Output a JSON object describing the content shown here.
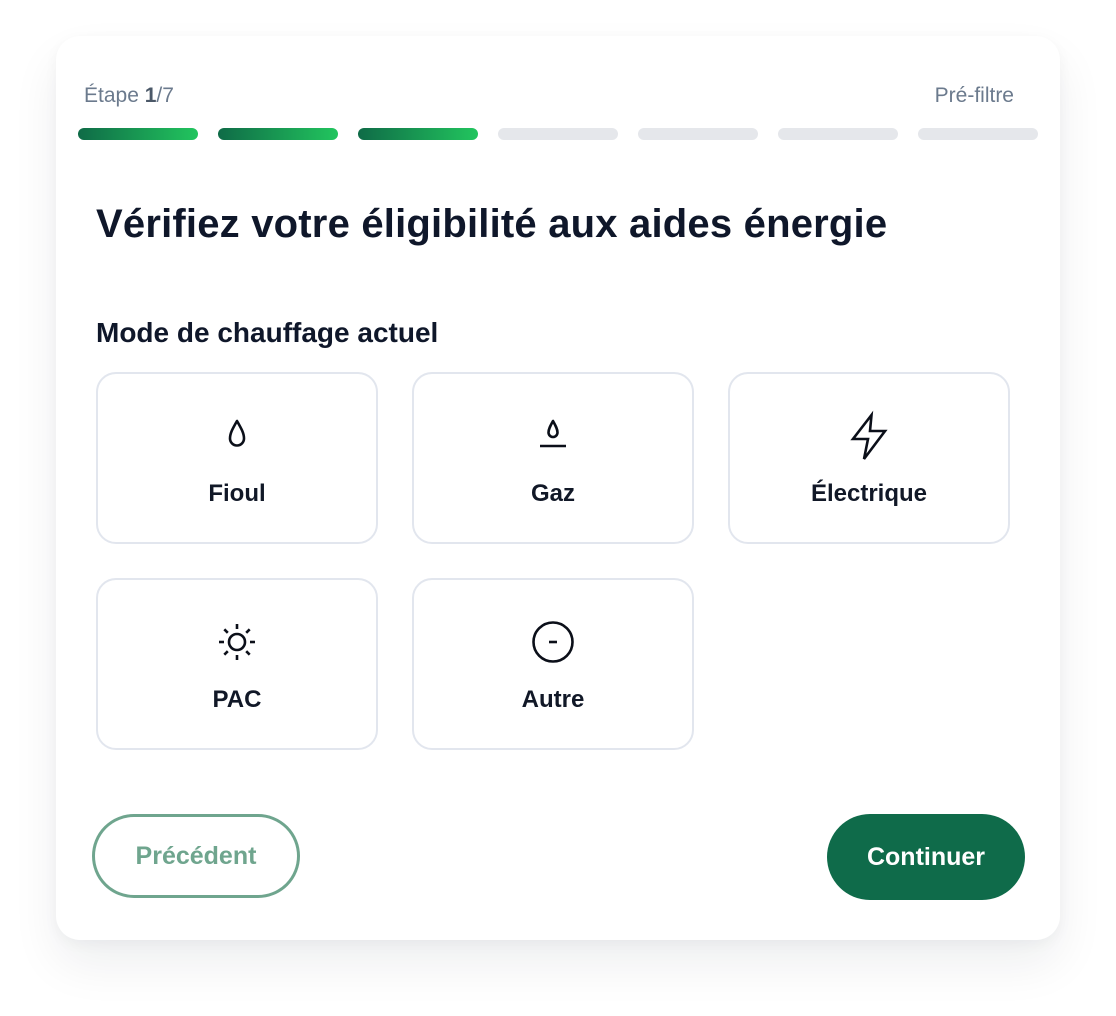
{
  "header": {
    "step_prefix": "Étape ",
    "step_current": "1",
    "step_suffix": "/7",
    "section_tag": "Pré-filtre"
  },
  "progress": {
    "total_steps": 7,
    "completed_steps": 3,
    "colors": {
      "done_start": "#0f6b47",
      "done_end": "#22c55e",
      "pending": "#e5e7eb"
    }
  },
  "main": {
    "title": "Vérifiez votre éligibilité aux aides énergie",
    "question": "Mode de chauffage actuel",
    "options": [
      {
        "label": "Fioul",
        "icon": "droplet-icon"
      },
      {
        "label": "Gaz",
        "icon": "gas-flame-icon"
      },
      {
        "label": "Électrique",
        "icon": "lightning-bolt-icon"
      },
      {
        "label": "PAC",
        "icon": "sun-icon"
      },
      {
        "label": "Autre",
        "icon": "minus-circle-icon"
      }
    ]
  },
  "footer": {
    "prev_label": "Précédent",
    "next_label": "Continuer"
  },
  "colors": {
    "brand": "#0f6b4a",
    "prev_outline": "#6fa58e",
    "text_dark": "#0f172a",
    "muted": "#6b7a8d"
  }
}
